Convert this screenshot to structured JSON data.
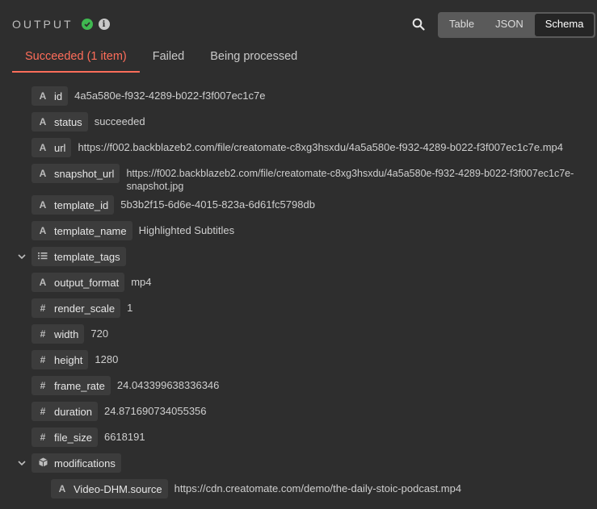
{
  "header": {
    "title": "OUTPUT"
  },
  "toolbar": {
    "views": [
      "Table",
      "JSON",
      "Schema"
    ],
    "active_view": "Schema"
  },
  "tabs": [
    {
      "label": "Succeeded (1 item)",
      "active": true
    },
    {
      "label": "Failed",
      "active": false
    },
    {
      "label": "Being processed",
      "active": false
    }
  ],
  "fields": [
    {
      "type": "string",
      "icon": "A",
      "key": "id",
      "value": "4a5a580e-f932-4289-b022-f3f007ec1c7e"
    },
    {
      "type": "string",
      "icon": "A",
      "key": "status",
      "value": "succeeded"
    },
    {
      "type": "string",
      "icon": "A",
      "key": "url",
      "value": "https://f002.backblazeb2.com/file/creatomate-c8xg3hsxdu/4a5a580e-f932-4289-b022-f3f007ec1c7e.mp4"
    },
    {
      "type": "string",
      "icon": "A",
      "key": "snapshot_url",
      "value_line1": "https://f002.backblazeb2.com/file/creatomate-c8xg3hsxdu/4a5a580e-f932-4289-b022-f3f007ec1c7e-",
      "value_line2": "snapshot.jpg"
    },
    {
      "type": "string",
      "icon": "A",
      "key": "template_id",
      "value": "5b3b2f15-6d6e-4015-823a-6d61fc5798db"
    },
    {
      "type": "string",
      "icon": "A",
      "key": "template_name",
      "value": "Highlighted Subtitles"
    },
    {
      "type": "array",
      "icon": "list",
      "key": "template_tags",
      "value": ""
    },
    {
      "type": "string",
      "icon": "A",
      "key": "output_format",
      "value": "mp4"
    },
    {
      "type": "number",
      "icon": "#",
      "key": "render_scale",
      "value": "1"
    },
    {
      "type": "number",
      "icon": "#",
      "key": "width",
      "value": "720"
    },
    {
      "type": "number",
      "icon": "#",
      "key": "height",
      "value": "1280"
    },
    {
      "type": "number",
      "icon": "#",
      "key": "frame_rate",
      "value": "24.043399638336346"
    },
    {
      "type": "number",
      "icon": "#",
      "key": "duration",
      "value": "24.871690734055356"
    },
    {
      "type": "number",
      "icon": "#",
      "key": "file_size",
      "value": "6618191"
    },
    {
      "type": "object",
      "icon": "cube",
      "key": "modifications",
      "value": ""
    },
    {
      "type": "string",
      "icon": "A",
      "key": "Video-DHM.source",
      "value": "https://cdn.creatomate.com/demo/the-daily-stoic-podcast.mp4"
    }
  ]
}
